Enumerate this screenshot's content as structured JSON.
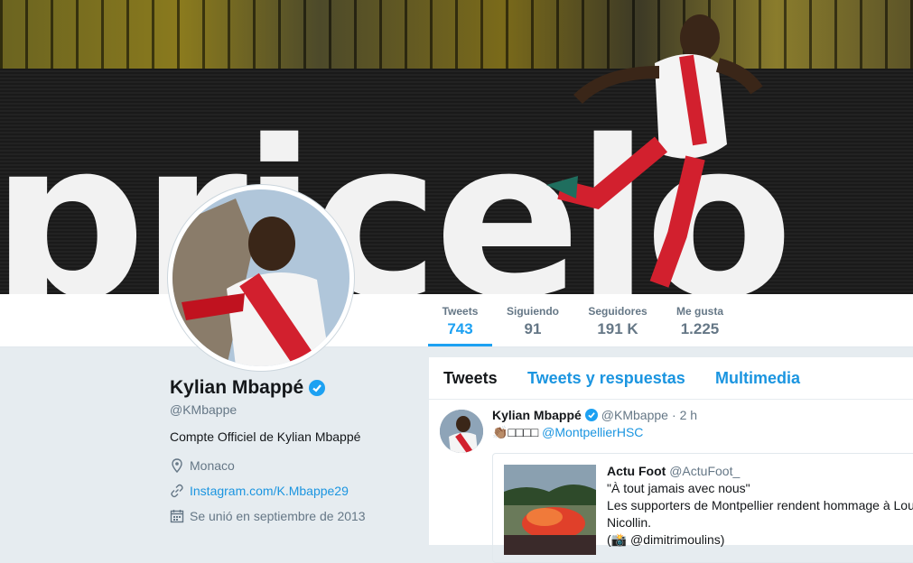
{
  "banner": {
    "ad_text": "pricelo"
  },
  "stats": [
    {
      "label": "Tweets",
      "value": "743"
    },
    {
      "label": "Siguiendo",
      "value": "91"
    },
    {
      "label": "Seguidores",
      "value": "191 K"
    },
    {
      "label": "Me gusta",
      "value": "1.225"
    }
  ],
  "profile": {
    "name": "Kylian Mbappé",
    "handle": "@KMbappe",
    "bio": "Compte Officiel de Kylian Mbappé",
    "location": "Monaco",
    "website": "Instagram.com/K.Mbappe29",
    "joined": "Se unió en septiembre de 2013"
  },
  "timeline": {
    "tabs": [
      "Tweets",
      "Tweets y respuestas",
      "Multimedia"
    ],
    "tweet": {
      "name": "Kylian Mbappé",
      "handle": "@KMbappe",
      "separator": "·",
      "time": "2 h",
      "emoji": "👏🏽",
      "boxes": "□□□□",
      "mention": "@MontpellierHSC",
      "quote": {
        "name": "Actu Foot",
        "handle": "@ActuFoot_",
        "line1": "\"À tout jamais avec nous\"",
        "line2": "Les supporters de Montpellier rendent hommage à Lou",
        "line3": "Nicollin.",
        "line4": "(📸 @dimitrimoulins)"
      }
    }
  },
  "colors": {
    "accent": "#1da1f2",
    "link": "#1b95e0",
    "muted": "#657786"
  }
}
